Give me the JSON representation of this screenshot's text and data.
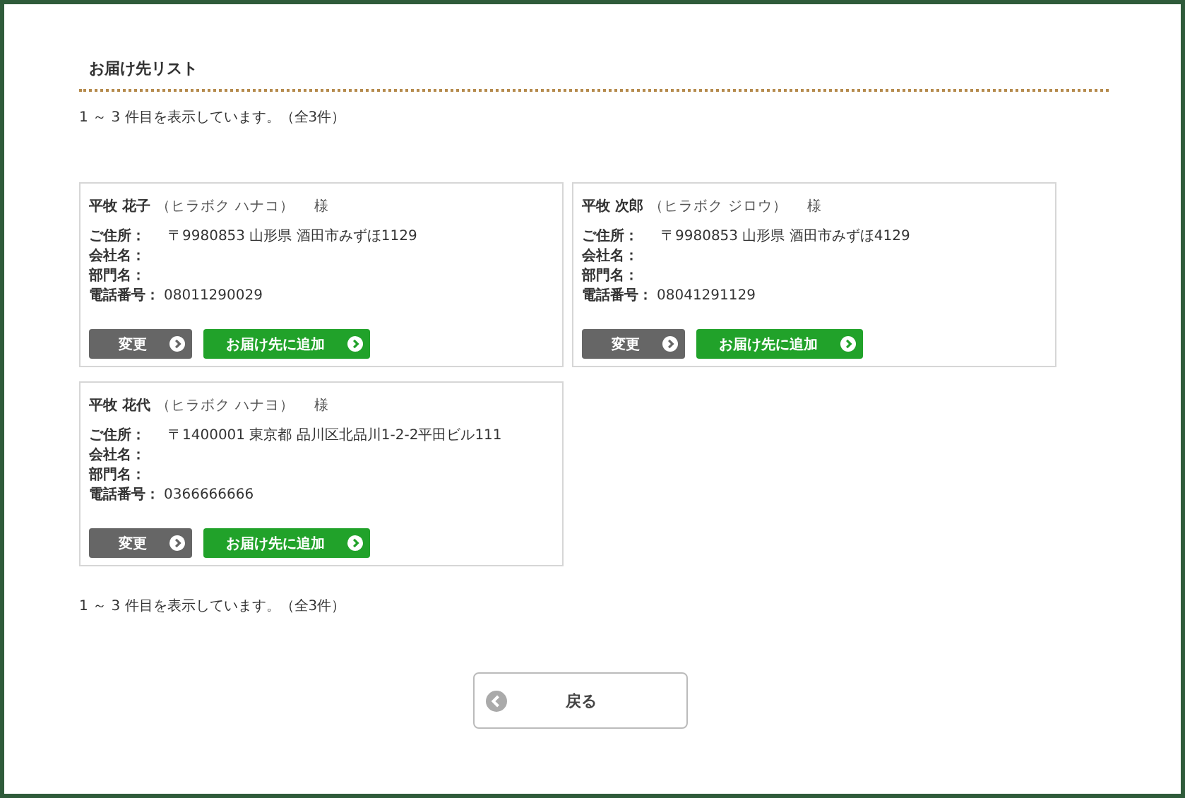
{
  "title": "お届け先リスト",
  "count_top": "1 ～ 3 件目を表示しています。（全3件）",
  "cards": [
    {
      "name": "平牧 花子",
      "kana": "（ヒラボク ハナコ）",
      "honorific": "様",
      "fields": [
        {
          "label": "ご住所：",
          "value": "〒9980853 山形県 酒田市みずほ1129"
        },
        {
          "label": "会社名："
        },
        {
          "label": "部門名："
        },
        {
          "label": "電話番号：",
          "value": "08011290029"
        }
      ],
      "buttons": [
        {
          "label": "変更",
          "kind": "edit"
        },
        {
          "label": "お届け先に追加",
          "kind": "add"
        }
      ]
    },
    {
      "name": "平牧 次郎",
      "kana": "（ヒラボク ジロウ）",
      "honorific": "様",
      "fields": [
        {
          "label": "ご住所：",
          "value": "〒9980853 山形県 酒田市みずほ4129"
        },
        {
          "label": "会社名："
        },
        {
          "label": "部門名："
        },
        {
          "label": "電話番号：",
          "value": "08041291129"
        }
      ],
      "buttons": [
        {
          "label": "変更",
          "kind": "edit"
        },
        {
          "label": "お届け先に追加",
          "kind": "add"
        }
      ]
    },
    {
      "name": "平牧 花代",
      "kana": "（ヒラボク ハナヨ）",
      "honorific": "様",
      "fields": [
        {
          "label": "ご住所：",
          "value": "〒1400001 東京都 品川区北品川1-2-2平田ビル111"
        },
        {
          "label": "会社名："
        },
        {
          "label": "部門名："
        },
        {
          "label": "電話番号：",
          "value": "0366666666"
        }
      ],
      "buttons": [
        {
          "label": "変更",
          "kind": "edit"
        },
        {
          "label": "お届け先に追加",
          "kind": "add"
        }
      ]
    }
  ],
  "count_bottom": "1 ～ 3 件目を表示しています。（全3件）",
  "back_button": "戻る"
}
